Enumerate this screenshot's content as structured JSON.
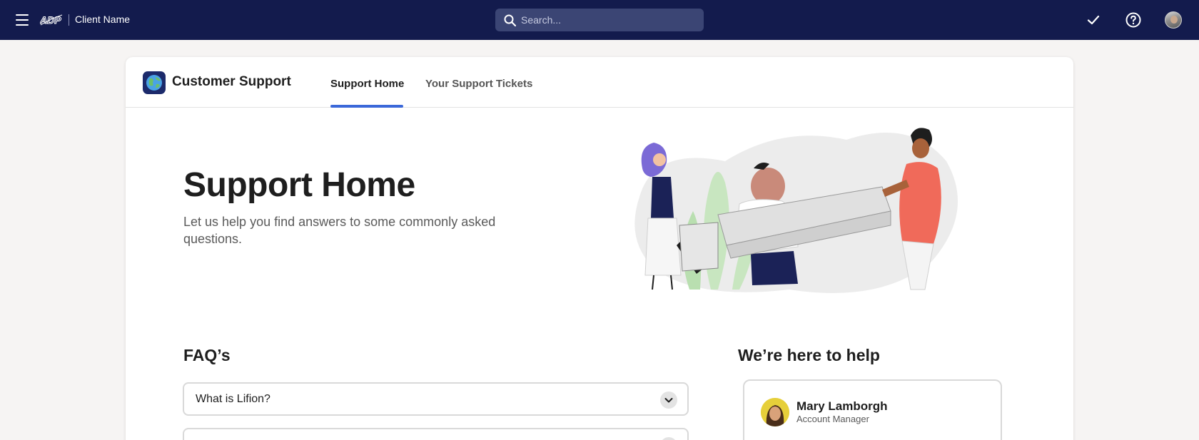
{
  "topbar": {
    "brand": "ADP",
    "client_name": "Client Name",
    "search_placeholder": "Search..."
  },
  "app": {
    "title": "Customer Support"
  },
  "tabs": [
    {
      "label": "Support Home",
      "active": true
    },
    {
      "label": "Your Support Tickets",
      "active": false
    }
  ],
  "hero": {
    "title": "Support Home",
    "subtitle": "Let us help you find answers to some commonly asked questions."
  },
  "faq": {
    "title": "FAQ’s",
    "items": [
      {
        "question": "What is Lifion?"
      },
      {
        "question": ""
      }
    ]
  },
  "help": {
    "title": "We’re here to help",
    "contact": {
      "name": "Mary Lamborgh",
      "role": "Account Manager"
    }
  },
  "colors": {
    "topbar_bg": "#131b4d",
    "accent": "#3b68d9",
    "page_bg": "#f6f4f3"
  },
  "icons": [
    "menu-icon",
    "adp-logo",
    "search-icon",
    "check-icon",
    "help-icon",
    "user-avatar",
    "globe-icon",
    "chevron-down-icon"
  ]
}
